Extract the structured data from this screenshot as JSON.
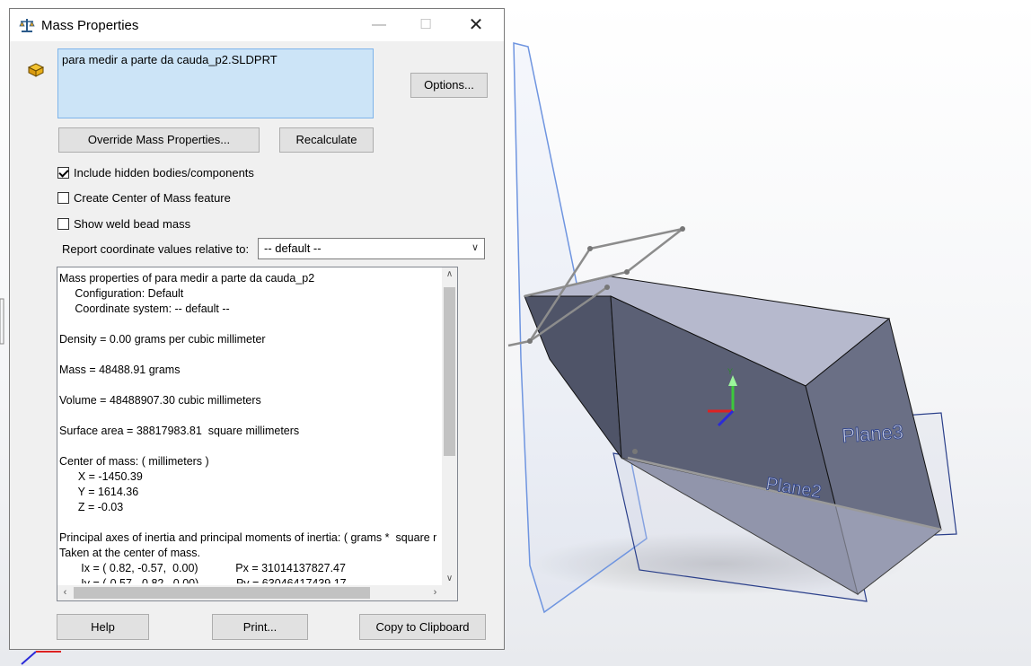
{
  "dialog": {
    "title": "Mass Properties",
    "minimize_glyph": "—",
    "maximize_glyph": "☐",
    "close_glyph": "✕",
    "file_name": "para medir a parte da cauda_p2.SLDPRT",
    "options_label": "Options...",
    "override_label": "Override Mass Properties...",
    "recalculate_label": "Recalculate",
    "checkboxes": [
      {
        "label": "Include hidden bodies/components",
        "checked": true
      },
      {
        "label": "Create Center of Mass feature",
        "checked": false
      },
      {
        "label": "Show weld bead mass",
        "checked": false
      }
    ],
    "report_label": "Report coordinate values relative to:",
    "report_value": "-- default --",
    "results_text": "Mass properties of para medir a parte da cauda_p2\n     Configuration: Default\n     Coordinate system: -- default --\n\nDensity = 0.00 grams per cubic millimeter\n\nMass = 48488.91 grams\n\nVolume = 48488907.30 cubic millimeters\n\nSurface area = 38817983.81  square millimeters\n\nCenter of mass: ( millimeters )\n      X = -1450.39\n      Y = 1614.36\n      Z = -0.03\n\nPrincipal axes of inertia and principal moments of inertia: ( grams *  square millimeters )\nTaken at the center of mass.\n       Ix = ( 0.82, -0.57,  0.00)            Px = 31014137827.47\n       Iy = (-0.57, -0.82,  0.00)            Py = 63046417439.17",
    "help_label": "Help",
    "print_label": "Print...",
    "copy_label": "Copy to Clipboard"
  },
  "viewport": {
    "plane_labels": [
      "Plane3",
      "Plane2"
    ],
    "triad_label": "Y",
    "colors": {
      "solid_top": "#b9bcd0",
      "solid_side": "#5a5f72",
      "plane_edge": "#6f95e0",
      "plane_dark": "#2a3f8a",
      "sketch": "#8c8c8c"
    }
  }
}
